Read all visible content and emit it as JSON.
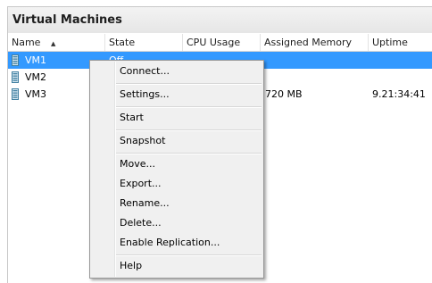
{
  "panel": {
    "title": "Virtual Machines"
  },
  "columns": [
    {
      "label": "Name"
    },
    {
      "label": "State"
    },
    {
      "label": "CPU Usage"
    },
    {
      "label": "Assigned Memory"
    },
    {
      "label": "Uptime"
    }
  ],
  "sort_icon": "sort-ascending-icon",
  "vm_icon": "server-icon",
  "rows": [
    {
      "name": "VM1",
      "state": "Off",
      "cpu": "",
      "memory": "",
      "uptime": "",
      "selected": true
    },
    {
      "name": "VM2",
      "state": "",
      "cpu": "",
      "memory": "",
      "uptime": "",
      "selected": false
    },
    {
      "name": "VM3",
      "state": "",
      "cpu": "",
      "memory": "720 MB",
      "uptime": "9.21:34:41",
      "selected": false
    }
  ],
  "context_menu": {
    "items": [
      {
        "label": "Connect..."
      },
      {
        "label": "Settings..."
      },
      {
        "label": "Start"
      },
      {
        "label": "Snapshot"
      },
      {
        "label": "Move..."
      },
      {
        "label": "Export..."
      },
      {
        "label": "Rename..."
      },
      {
        "label": "Delete..."
      },
      {
        "label": "Enable Replication..."
      },
      {
        "label": "Help"
      }
    ]
  },
  "colors": {
    "selection": "#3399ff",
    "menu_background": "#f0f0f0",
    "header_background": "#ebebeb"
  }
}
